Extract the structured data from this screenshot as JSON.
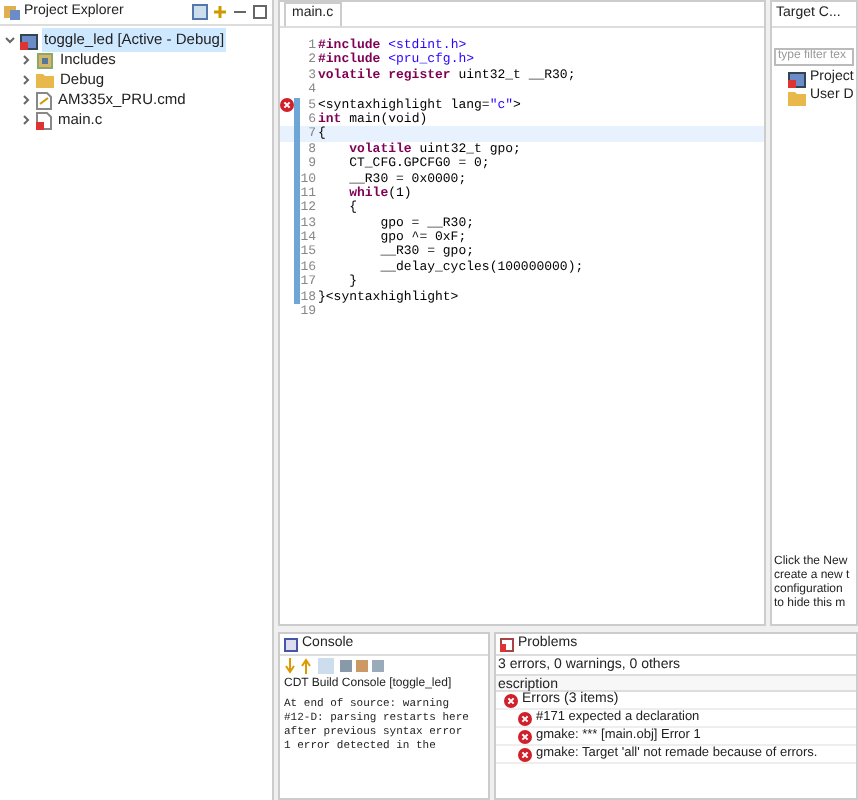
{
  "project_explorer": {
    "title": "Project Explorer",
    "tree": [
      {
        "label": "toggle_led",
        "suffix": "[Active - Debug]",
        "kind": "project",
        "expanded": true,
        "selected": true,
        "children": [
          {
            "label": "Includes",
            "kind": "includes",
            "expanded": false,
            "selected": false
          },
          {
            "label": "Debug",
            "kind": "folder",
            "expanded": false,
            "selected": false
          },
          {
            "label": "AM335x_PRU.cmd",
            "kind": "file",
            "expanded": false,
            "selected": false
          },
          {
            "label": "main.c",
            "kind": "source",
            "expanded": false,
            "selected": false
          }
        ]
      }
    ]
  },
  "editor": {
    "tab": "main.c",
    "lines": [
      {
        "number": "1",
        "error": false,
        "current": false,
        "changed": false,
        "tokens": [
          {
            "kind": "keyword",
            "text": "#include "
          },
          {
            "kind": "string",
            "text": "<stdint.h>"
          }
        ]
      },
      {
        "number": "2",
        "error": false,
        "current": false,
        "changed": false,
        "tokens": [
          {
            "kind": "keyword",
            "text": "#include "
          },
          {
            "kind": "string",
            "text": "<pru_cfg.h>"
          }
        ]
      },
      {
        "number": "3",
        "error": false,
        "current": false,
        "changed": false,
        "tokens": [
          {
            "kind": "keyword",
            "text": "volatile register "
          },
          {
            "kind": "plain",
            "text": "uint32_t __R30;"
          }
        ]
      },
      {
        "number": "4",
        "error": false,
        "current": false,
        "changed": false
      },
      {
        "number": "5",
        "error": true,
        "current": false,
        "changed": true,
        "tokens": [
          {
            "kind": "plain",
            "text": "<syntaxhighlight lang="
          },
          {
            "kind": "string",
            "text": "\"c\""
          },
          {
            "kind": "plain",
            "text": ">"
          }
        ]
      },
      {
        "number": "6",
        "error": false,
        "current": false,
        "changed": true,
        "tokens": [
          {
            "kind": "keyword",
            "text": "int "
          },
          {
            "kind": "plain",
            "text": "main(void)"
          }
        ]
      },
      {
        "number": "7",
        "error": false,
        "current": true,
        "changed": true,
        "tokens": [
          {
            "kind": "plain",
            "text": "{"
          }
        ]
      },
      {
        "number": "8",
        "error": false,
        "current": false,
        "changed": true,
        "tokens": [
          {
            "kind": "keyword",
            "text": "    volatile "
          },
          {
            "kind": "plain",
            "text": "uint32_t gpo;"
          }
        ]
      },
      {
        "number": "9",
        "error": false,
        "current": false,
        "changed": true,
        "tokens": [
          {
            "kind": "plain",
            "text": "    CT_CFG.GPCFG0 = 0;"
          }
        ]
      },
      {
        "number": "10",
        "error": false,
        "current": false,
        "changed": true,
        "tokens": [
          {
            "kind": "plain",
            "text": "    __R30 = 0x0000;"
          }
        ]
      },
      {
        "number": "11",
        "error": false,
        "current": false,
        "changed": true,
        "tokens": [
          {
            "kind": "keyword",
            "text": "    while"
          },
          {
            "kind": "plain",
            "text": "(1)"
          }
        ]
      },
      {
        "number": "12",
        "error": false,
        "current": false,
        "changed": true,
        "tokens": [
          {
            "kind": "plain",
            "text": "    {"
          }
        ]
      },
      {
        "number": "13",
        "error": false,
        "current": false,
        "changed": true,
        "tokens": [
          {
            "kind": "plain",
            "text": "        gpo = __R30;"
          }
        ]
      },
      {
        "number": "14",
        "error": false,
        "current": false,
        "changed": true,
        "tokens": [
          {
            "kind": "plain",
            "text": "        gpo ^= 0xF;"
          }
        ]
      },
      {
        "number": "15",
        "error": false,
        "current": false,
        "changed": true,
        "tokens": [
          {
            "kind": "plain",
            "text": "        __R30 = gpo;"
          }
        ]
      },
      {
        "number": "16",
        "error": false,
        "current": false,
        "changed": true,
        "tokens": [
          {
            "kind": "plain",
            "text": "        __delay_cycles(100000000);"
          }
        ]
      },
      {
        "number": "17",
        "error": false,
        "current": false,
        "changed": true,
        "tokens": [
          {
            "kind": "plain",
            "text": "    }"
          }
        ]
      },
      {
        "number": "18",
        "error": false,
        "current": false,
        "changed": true,
        "tokens": [
          {
            "kind": "plain",
            "text": "}<syntaxhighlight>"
          }
        ]
      },
      {
        "number": "19",
        "error": false,
        "current": false,
        "changed": false
      }
    ]
  },
  "target_panel": {
    "title": "Target C...",
    "filter": {
      "placeholder": "type filter tex"
    },
    "items": [
      {
        "label": "Project",
        "kind": "project"
      },
      {
        "label": "User D",
        "kind": "folder"
      }
    ],
    "hint_lines": [
      "Click the New",
      "create a new t",
      "configuration",
      "to hide this m"
    ]
  },
  "console": {
    "title": "Console",
    "subtitle": "CDT Build Console [toggle_led]",
    "lines": [
      "At end of source: warning",
      "#12-D: parsing restarts here",
      "after previous syntax error",
      "1 error detected in the"
    ]
  },
  "problems": {
    "title": "Problems",
    "summary": "3 errors, 0 warnings, 0 others",
    "column": "escription",
    "group": {
      "label": "Errors (3 items)",
      "expanded": true,
      "items": [
        "#171 expected a declaration",
        "gmake: *** [main.obj] Error 1",
        "gmake: Target 'all' not remade because of errors."
      ]
    }
  }
}
